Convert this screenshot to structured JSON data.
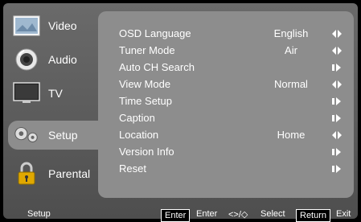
{
  "sidebar": {
    "items": [
      {
        "label": "Video",
        "icon": "video-icon"
      },
      {
        "label": "Audio",
        "icon": "audio-icon"
      },
      {
        "label": "TV",
        "icon": "tv-icon"
      },
      {
        "label": "Setup",
        "icon": "gears-icon",
        "active": true
      },
      {
        "label": "Parental",
        "icon": "padlock-icon"
      }
    ]
  },
  "menu": {
    "rows": [
      {
        "label": "OSD Language",
        "value": "English",
        "arrow": "both"
      },
      {
        "label": "Tuner Mode",
        "value": "Air",
        "arrow": "both"
      },
      {
        "label": "Auto CH Search",
        "value": "",
        "arrow": "right"
      },
      {
        "label": "View Mode",
        "value": "Normal",
        "arrow": "both"
      },
      {
        "label": "Time Setup",
        "value": "",
        "arrow": "right"
      },
      {
        "label": "Caption",
        "value": "",
        "arrow": "right"
      },
      {
        "label": "Location",
        "value": "Home",
        "arrow": "both"
      },
      {
        "label": "Version Info",
        "value": "",
        "arrow": "right"
      },
      {
        "label": "Reset",
        "value": "",
        "arrow": "right"
      }
    ]
  },
  "footer": {
    "section": "Setup",
    "enter_key": "Enter",
    "enter_action": "Enter",
    "nav_key": "<>/◇",
    "nav_action": "Select",
    "return_key": "Return",
    "return_action": "Exit"
  }
}
